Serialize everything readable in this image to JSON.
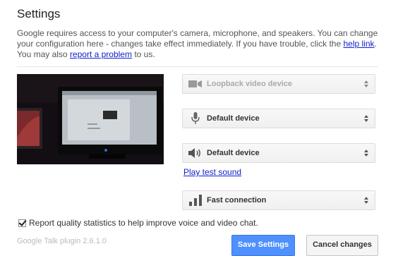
{
  "header": {
    "title": "Settings"
  },
  "description": {
    "part1": "Google requires access to your computer's camera, microphone, and speakers. You can change your configuration here - changes take effect immediately. If you have trouble, click the ",
    "help_link": "help link",
    "part2": ". You may also ",
    "report_link": "report a problem",
    "part3": " to us."
  },
  "devices": {
    "camera": {
      "icon": "video-camera-icon",
      "value": "Loopback video device",
      "disabled": true
    },
    "microphone": {
      "icon": "microphone-icon",
      "value": "Default device"
    },
    "speaker": {
      "icon": "speaker-icon",
      "value": "Default device"
    },
    "play_test_sound": "Play test sound",
    "bandwidth": {
      "icon": "signal-bars-icon",
      "value": "Fast connection"
    }
  },
  "report_quality": {
    "label": "Report quality statistics to help improve voice and video chat.",
    "checked": true
  },
  "footer": {
    "version": "Google Talk plugin 2.6.1.0",
    "save_label": "Save Settings",
    "cancel_label": "Cancel changes"
  },
  "colors": {
    "link": "#1122cc",
    "primary": "#4d90fe"
  }
}
